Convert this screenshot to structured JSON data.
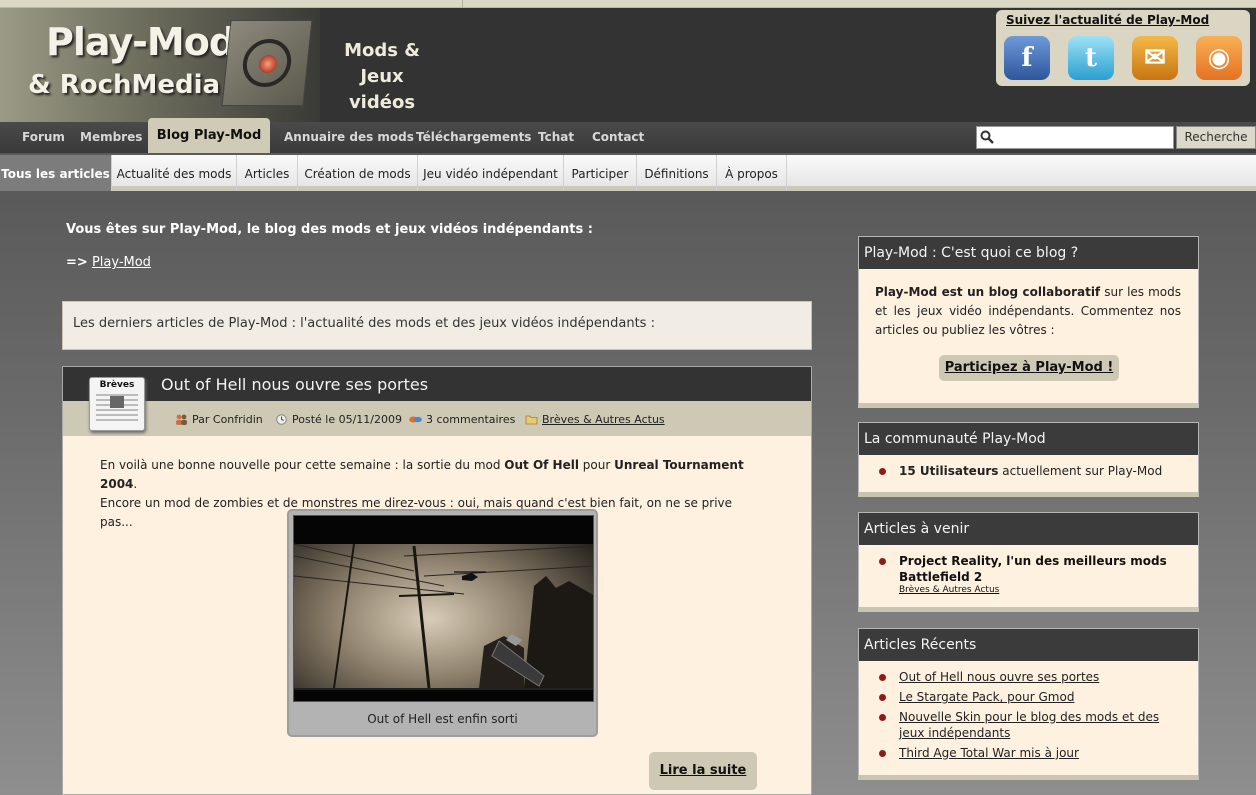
{
  "header": {
    "logo_line1": "Play-Mod",
    "logo_line2": "& RochMedia",
    "tagline_1": "Mods &",
    "tagline_2": "Jeux vidéos",
    "social_title": "Suivez l'actualité de Play-Mod",
    "social": [
      {
        "icon": "facebook-icon",
        "glyph": "f"
      },
      {
        "icon": "twitter-icon",
        "glyph": "t"
      },
      {
        "icon": "email-icon",
        "glyph": "✉"
      },
      {
        "icon": "rss-icon",
        "glyph": "◉"
      }
    ]
  },
  "nav": {
    "items": [
      "Forum",
      "Membres",
      "Blog Play-Mod",
      "Annuaire des mods",
      "Téléchargements",
      "Tchat",
      "Contact"
    ],
    "active": "Blog Play-Mod",
    "search_placeholder": "",
    "search_button": "Recherche"
  },
  "subnav": {
    "items": [
      "Tous les articles",
      "Actualité des mods",
      "Articles",
      "Création de mods",
      "Jeu vidéo indépendant",
      "Participer",
      "Définitions",
      "À propos"
    ],
    "active": "Tous les articles"
  },
  "main": {
    "intro": "Vous êtes sur Play-Mod, le blog des mods et jeux vidéos indépendants :",
    "crumb_arrow": "=>",
    "crumb_link": "Play-Mod",
    "latest": "Les derniers articles de Play-Mod : l'actualité des mods et des jeux vidéos indépendants :",
    "post": {
      "category_badge": "Brèves",
      "title": "Out of Hell nous ouvre ses portes",
      "author": "Par Confridin",
      "date": "Posté le 05/11/2009",
      "comments": "3 commentaires",
      "category": "Brèves & Autres Actus",
      "body_1a": "En voilà une bonne nouvelle pour cette semaine : la sortie du mod ",
      "body_1b": "Out Of Hell",
      "body_1c": " pour ",
      "body_1d": "Unreal Tournament 2004",
      "body_1e": ".",
      "body_2": "Encore un mod de zombies et de monstres me direz-vous : oui, mais quand c'est bien fait, on ne se prive pas...",
      "caption": "Out of Hell est enfin sorti",
      "read_more": "Lire la suite"
    }
  },
  "sidebar": {
    "w1": {
      "title": "Play-Mod : C'est quoi ce blog ?",
      "text_bold": "Play-Mod est un blog collaboratif",
      "text_rest": " sur les mods et les jeux vidéo indépendants. Commentez nos articles ou publiez les vôtres :",
      "button": "Participez à Play-Mod !"
    },
    "w2": {
      "title": "La communauté Play-Mod",
      "count": "15 Utilisateurs",
      "text": " actuellement sur Play-Mod"
    },
    "w3": {
      "title": "Articles à venir",
      "item": "Project Reality, l'un des meilleurs mods Battlefield 2",
      "item_category": "Brèves & Autres Actus"
    },
    "w4": {
      "title": "Articles Récents",
      "items": [
        "Out of Hell nous ouvre ses portes",
        "Le Stargate Pack, pour Gmod",
        "Nouvelle Skin pour le blog des mods et des jeux indépendants",
        "Third Age Total War mis à jour"
      ]
    }
  }
}
